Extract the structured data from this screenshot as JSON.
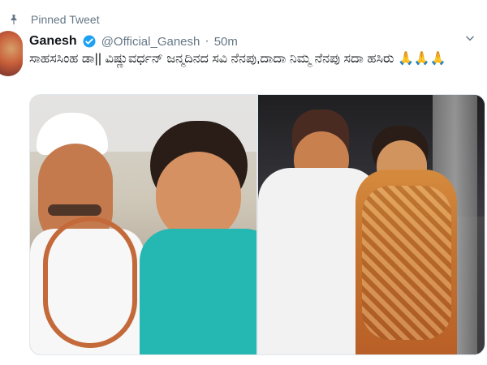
{
  "pinned": {
    "label": "Pinned Tweet",
    "icon": "pin-icon"
  },
  "tweet": {
    "author_name": "Ganesh",
    "verified_icon": "verified-badge-icon",
    "handle": "@Official_Ganesh",
    "separator": "·",
    "time": "50m",
    "text": "ಸಾಹಸಸಿಂಹ ಡಾ|| ವಿಷ್ಣುವರ್ಧನ್ ಜನ್ಮದಿನದ ಸವಿ ನೆನಪು,ದಾದಾ ನಿಮ್ಮ ನೆನಪು ಸದಾ ಹಸಿರು 🙏🙏🙏",
    "menu_icon": "chevron-down-icon"
  },
  "colors": {
    "text": "#14171a",
    "secondary": "#657786",
    "verified": "#1da1f2",
    "border": "#e1e8ed"
  }
}
